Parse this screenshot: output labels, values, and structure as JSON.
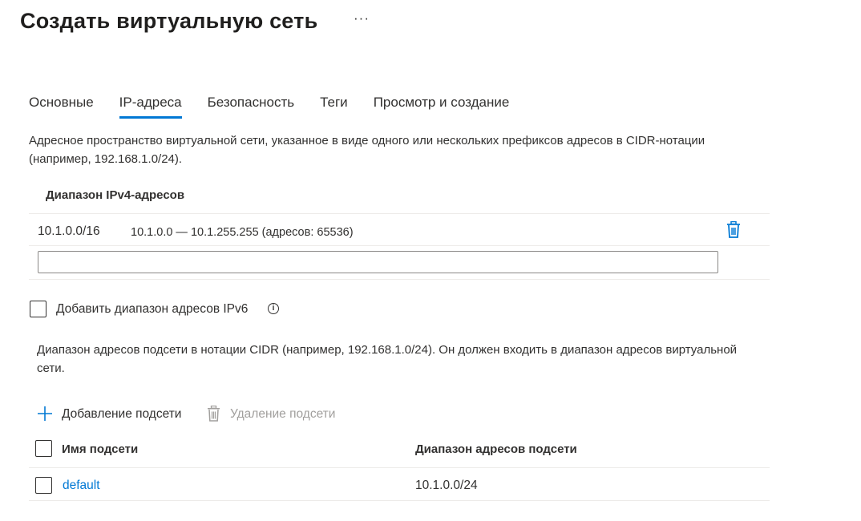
{
  "page": {
    "title": "Создать виртуальную сеть",
    "more_label": "···"
  },
  "tabs": [
    {
      "label": "Основные",
      "active": false
    },
    {
      "label": "IP-адреса",
      "active": true
    },
    {
      "label": "Безопасность",
      "active": false
    },
    {
      "label": "Теги",
      "active": false
    },
    {
      "label": "Просмотр и создание",
      "active": false
    }
  ],
  "address_space": {
    "description": "Адресное пространство виртуальной сети, указанное в виде одного или нескольких префиксов адресов в CIDR-нотации (например, 192.168.1.0/24).",
    "column_header": "Диапазон IPv4-адресов",
    "rows": [
      {
        "prefix": "10.1.0.0/16",
        "range": "10.1.0.0 — 10.1.255.255 (адресов: 65536)"
      }
    ],
    "new_input_value": "",
    "ipv6_checkbox_label": "Добавить диапазон адресов IPv6",
    "ipv6_checked": false
  },
  "subnets": {
    "description": "Диапазон адресов подсети в нотации CIDR (например, 192.168.1.0/24). Он должен входить в диапазон адресов виртуальной сети.",
    "add_label": "Добавление подсети",
    "delete_label": "Удаление подсети",
    "columns": [
      "Имя подсети",
      "Диапазон адресов подсети"
    ],
    "rows": [
      {
        "name": "default",
        "range": "10.1.0.0/24"
      }
    ]
  },
  "colors": {
    "accent": "#0078d4",
    "text": "#323130",
    "disabled": "#a19f9d",
    "divider": "#edebe9"
  }
}
